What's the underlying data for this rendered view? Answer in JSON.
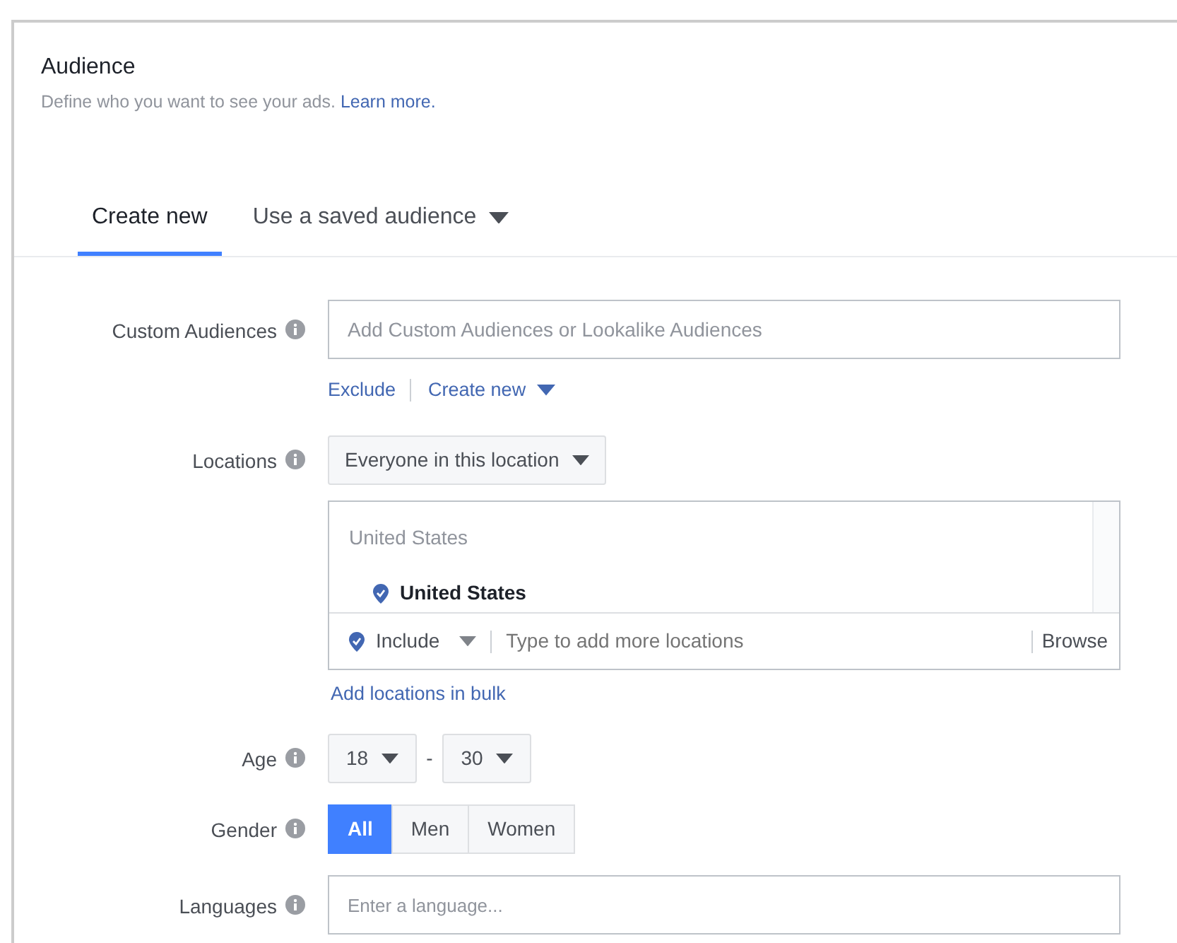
{
  "section": {
    "title": "Audience",
    "description": "Define who you want to see your ads.",
    "link": "Learn more."
  },
  "tabs": [
    {
      "label": "Create new",
      "selected": true,
      "dropdown": false
    },
    {
      "label": "Use a saved audience",
      "selected": false,
      "dropdown": true
    }
  ],
  "custom_audiences": {
    "label": "Custom Audiences",
    "placeholder": "Add Custom Audiences or Lookalike Audiences",
    "actions": [
      {
        "label": "Exclude",
        "dropdown": false
      },
      {
        "label": "Create new",
        "dropdown": true
      }
    ]
  },
  "locations": {
    "label": "Locations",
    "filter": "Everyone in this location",
    "list_heading": "United States",
    "items": [
      "United States"
    ],
    "include": "Include",
    "placeholder": "Type to add more locations",
    "browse": "Browse",
    "bulk_link": "Add locations in bulk"
  },
  "age": {
    "label": "Age",
    "min": "18",
    "separator": "-",
    "max": "30"
  },
  "gender": {
    "label": "Gender",
    "options": [
      {
        "label": "All",
        "selected": true
      },
      {
        "label": "Men",
        "selected": false
      },
      {
        "label": "Women",
        "selected": false
      }
    ]
  },
  "languages": {
    "label": "Languages",
    "placeholder": "Enter a language..."
  }
}
